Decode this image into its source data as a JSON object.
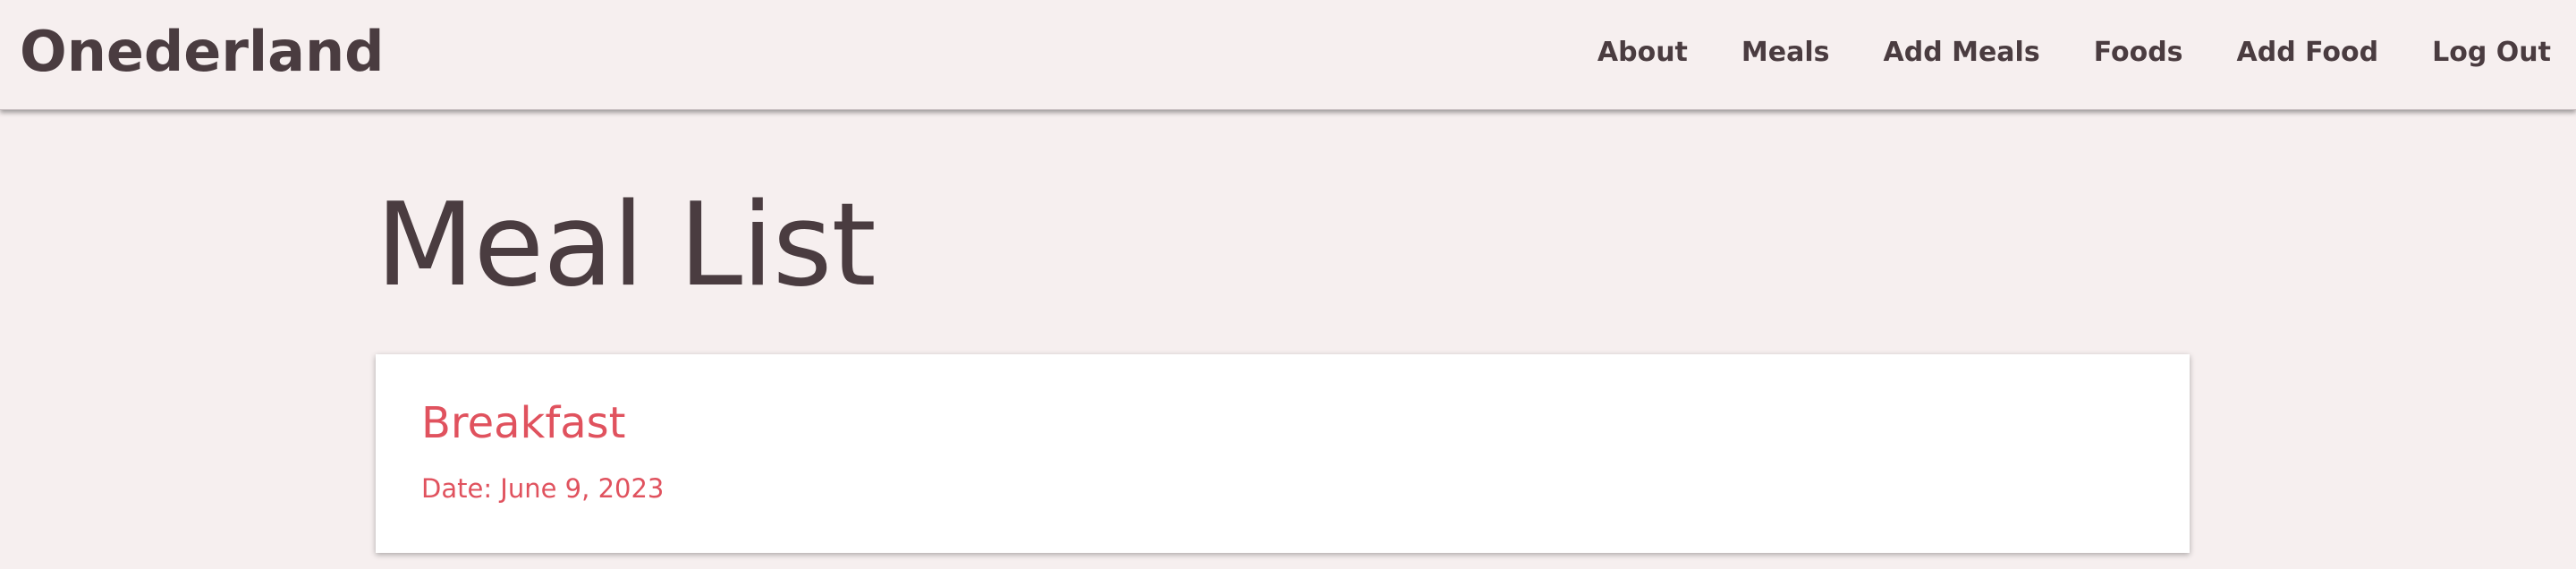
{
  "navbar": {
    "brand": "Onederland",
    "links": [
      {
        "label": "About"
      },
      {
        "label": "Meals"
      },
      {
        "label": "Add Meals"
      },
      {
        "label": "Foods"
      },
      {
        "label": "Add Food"
      },
      {
        "label": "Log Out"
      }
    ]
  },
  "main": {
    "title": "Meal List",
    "meals": [
      {
        "name": "Breakfast",
        "date": "Date: June 9, 2023"
      }
    ]
  },
  "colors": {
    "background": "#f6efef",
    "text": "#4a3c40",
    "accent": "#e0525e",
    "card": "#ffffff"
  }
}
